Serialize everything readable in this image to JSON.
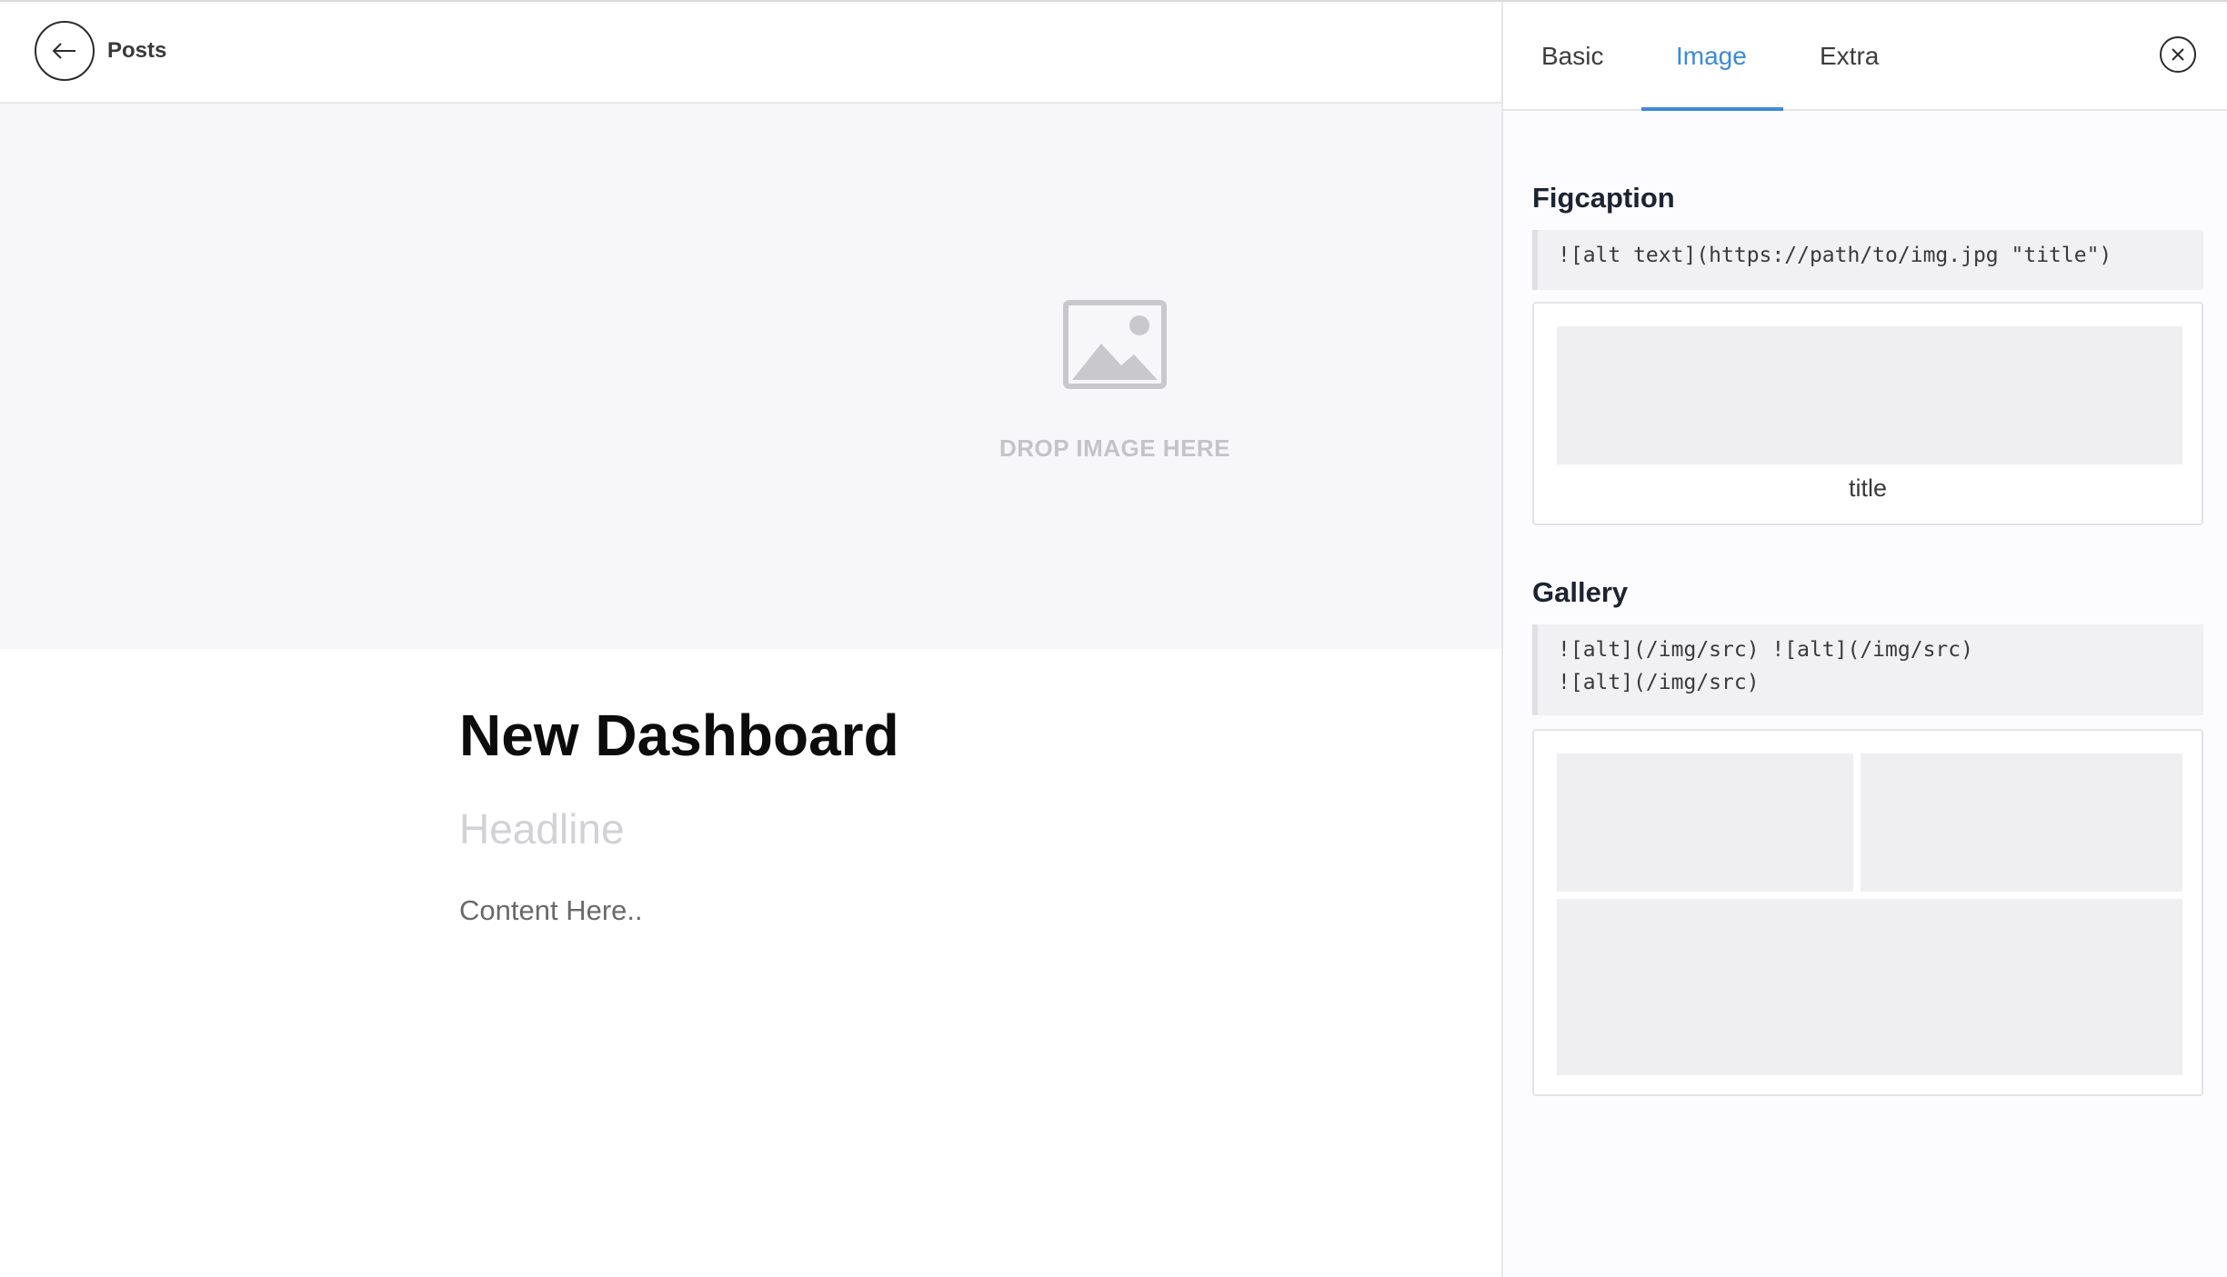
{
  "header": {
    "back_label": "Posts"
  },
  "cover": {
    "drop_label": "DROP IMAGE HERE"
  },
  "post": {
    "title": "New Dashboard",
    "headline": "Headline",
    "content": "Content Here.."
  },
  "panel": {
    "tabs": [
      {
        "label": "Basic",
        "active": false
      },
      {
        "label": "Image",
        "active": true
      },
      {
        "label": "Extra",
        "active": false
      }
    ],
    "figcaption": {
      "title": "Figcaption",
      "code": "![alt text](https://path/to/img.jpg \"title\")",
      "caption": "title"
    },
    "gallery": {
      "title": "Gallery",
      "code_lines": [
        "![alt](/img/src) ![alt](/img/src)",
        "![alt](/img/src)"
      ]
    }
  },
  "colors": {
    "accent": "#3c8ad8",
    "cover_bg": "#f7f6f8",
    "placeholder": "#efeff1"
  }
}
